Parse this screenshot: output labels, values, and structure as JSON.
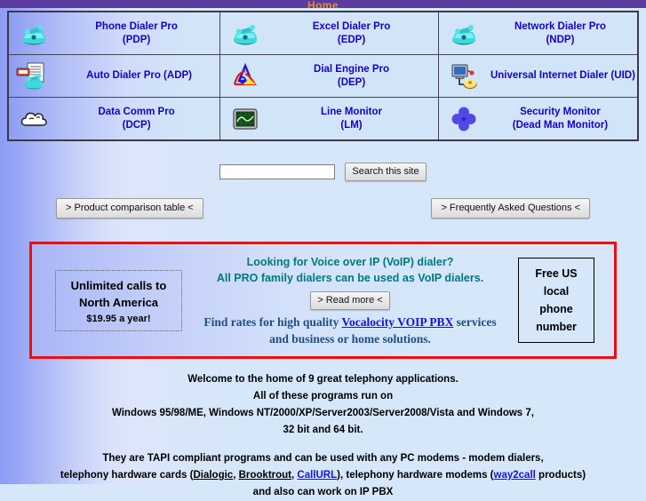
{
  "topbar": {
    "home_label": "Home",
    "bar_color": "#5b3b9e",
    "text_color": "#f08a1e"
  },
  "products": {
    "rows": [
      [
        {
          "icon": "phone-icon",
          "title": "Phone Dialer Pro",
          "abbr": "(PDP)"
        },
        {
          "icon": "phone-icon",
          "title": "Excel Dialer Pro",
          "abbr": "(EDP)"
        },
        {
          "icon": "phone-icon",
          "title": "Network Dialer Pro",
          "abbr": "(NDP)"
        }
      ],
      [
        {
          "icon": "auto-dialer-icon",
          "title": "Auto Dialer Pro (ADP)",
          "abbr": ""
        },
        {
          "icon": "dial-engine-icon",
          "title": "Dial Engine Pro",
          "abbr": "(DEP)"
        },
        {
          "icon": "internet-dialer-icon",
          "title": "Universal Internet Dialer (UID)",
          "abbr": ""
        }
      ],
      [
        {
          "icon": "cloud-icon",
          "title": "Data Comm Pro",
          "abbr": "(DCP)"
        },
        {
          "icon": "oscilloscope-icon",
          "title": "Line Monitor",
          "abbr": "(LM)"
        },
        {
          "icon": "clover-icon",
          "title": "Security Monitor",
          "abbr": "(Dead Man Monitor)"
        }
      ]
    ],
    "link_color": "#1500c8"
  },
  "search": {
    "value": "",
    "placeholder": "",
    "button_label": "Search this site"
  },
  "nav_buttons": {
    "comparison_label": "> Product comparison table <",
    "faq_label": "> Frequently Asked Questions <"
  },
  "promo": {
    "border_color": "#f40c0c",
    "left_box": {
      "line1": "Unlimited calls to",
      "line2": "North America",
      "line3": "$19.95 a year!"
    },
    "headline1": "Looking for Voice over IP (VoIP) dialer?",
    "headline2": "All PRO family dialers can be used as VoIP dialers.",
    "read_more_label": "> Read more <",
    "rates_pre": "Find rates for high quality ",
    "rates_link": "Vocalocity VOIP PBX",
    "rates_post": " services",
    "rates_line2": "and business or home solutions.",
    "right_box": {
      "line1": "Free US",
      "line2": "local",
      "line3": "phone",
      "line4": "number"
    },
    "teal_color": "#00787e"
  },
  "body_copy": {
    "welcome": "Welcome to the home of 9 great telephony applications.",
    "runs_on": "All of these programs run on",
    "os_line": "Windows 95/98/ME, Windows NT/2000/XP/Server2003/Server2008/Vista and Windows 7,",
    "bits_line": "32 bit and 64 bit.",
    "tapi_line": "They are  TAPI compliant programs and can be used with any PC modems - modem dialers,",
    "hw_pre": "telephony hardware cards (",
    "hw_link1": "Dialogic",
    "hw_mid1": ", ",
    "hw_link2": "Brooktrout",
    "hw_mid2": ", ",
    "hw_link3": "CallURL",
    "hw_mid3": "), telephony hardware modems (",
    "hw_link4": "way2call",
    "hw_post": " products)",
    "cut_line": "and also can work on IP PBX"
  }
}
